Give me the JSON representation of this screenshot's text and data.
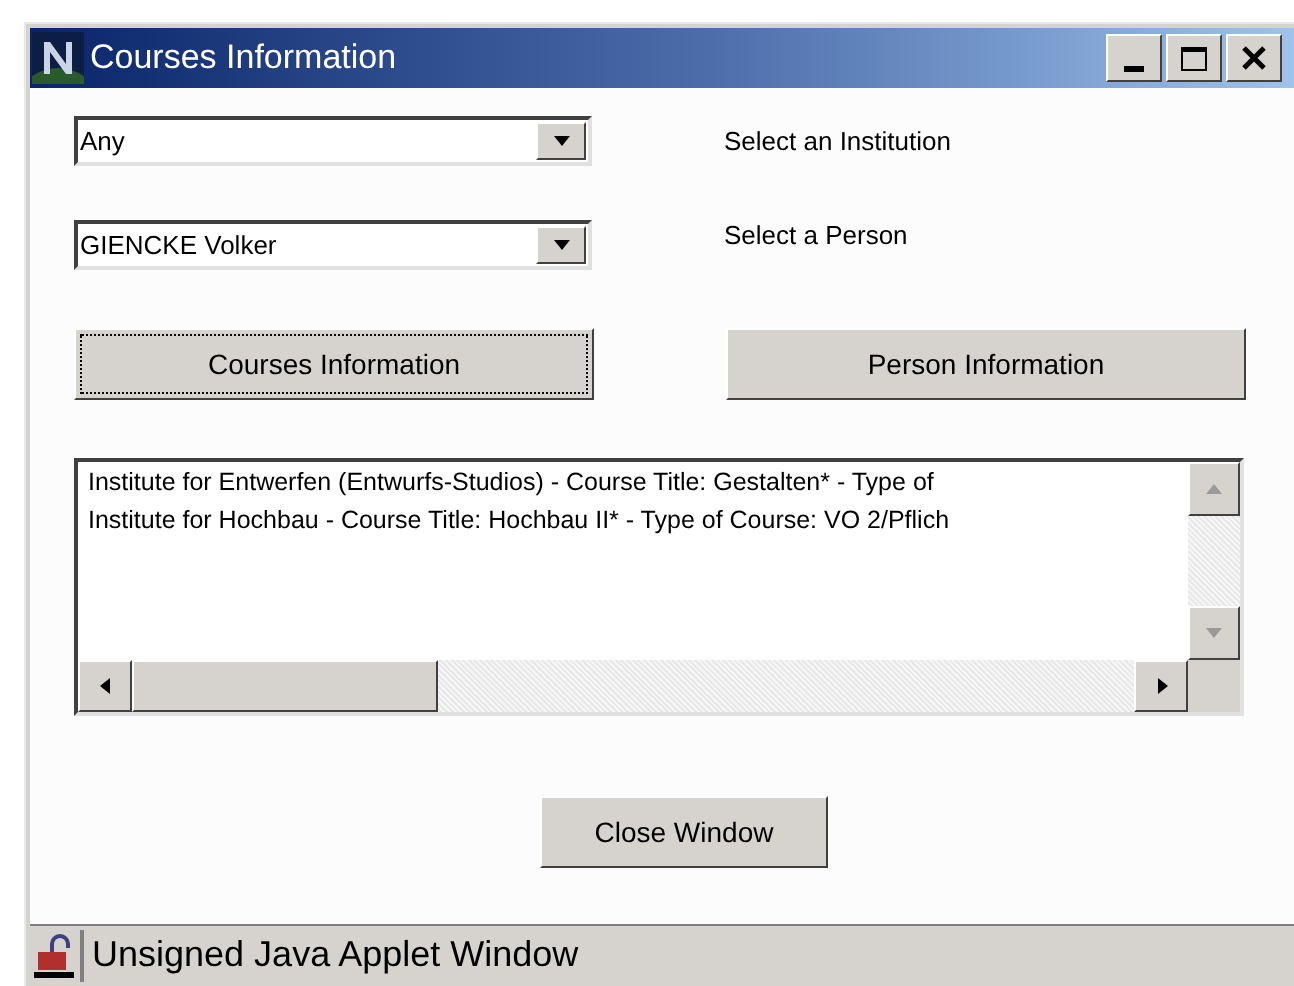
{
  "window": {
    "title": "Courses Information"
  },
  "selects": [
    {
      "value": "Any",
      "label": "Select an Institution"
    },
    {
      "value": "GIENCKE Volker",
      "label": "Select a Person"
    }
  ],
  "buttons": [
    {
      "label": "Courses Information",
      "focused": true
    },
    {
      "label": "Person Information",
      "focused": false
    }
  ],
  "list": {
    "rows": [
      "Institute for Entwerfen (Entwurfs-Studios) - Course Title: Gestalten* - Type of",
      "Institute for Hochbau - Course Title: Hochbau II* - Type of Course: VO 2/Pflich"
    ]
  },
  "close_button": {
    "label": "Close Window"
  },
  "status_bar": {
    "text": "Unsigned Java Applet Window"
  }
}
